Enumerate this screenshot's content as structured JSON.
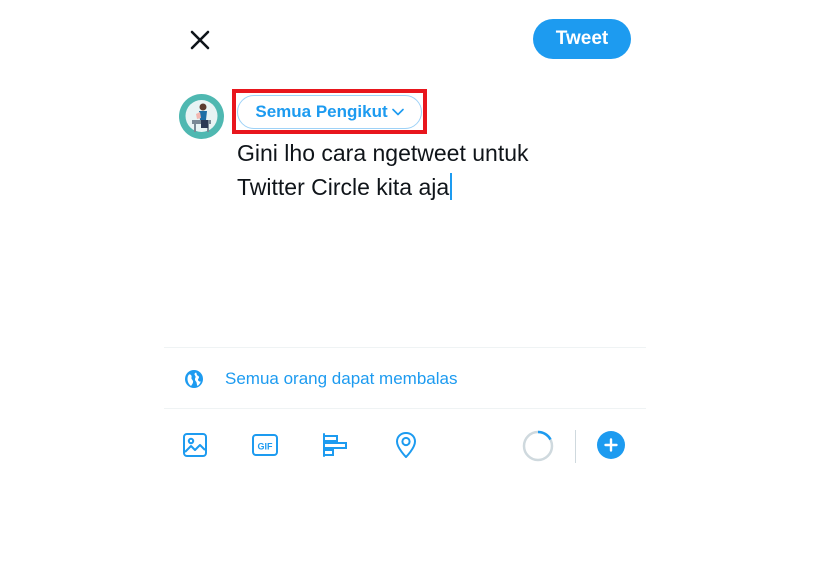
{
  "header": {
    "close_icon": "close-icon",
    "tweet_label": "Tweet",
    "accent_color": "#1d9bf0"
  },
  "composer": {
    "audience_label": "Semua Pengikut",
    "text_lines": [
      "Gini lho cara ngetweet untuk",
      "Twitter Circle kita aja"
    ]
  },
  "reply": {
    "icon": "globe-icon",
    "label": "Semua orang dapat membalas"
  },
  "toolbar": {
    "icons": [
      "image-icon",
      "gif-icon",
      "poll-icon",
      "location-icon"
    ],
    "gif_text": "GIF",
    "progress_icon": "character-count-ring",
    "add_icon": "plus-icon"
  }
}
